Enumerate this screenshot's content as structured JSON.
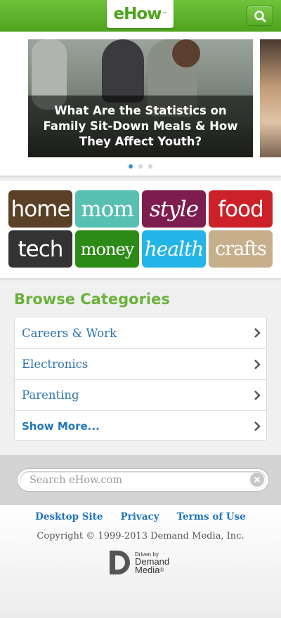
{
  "header": {
    "logo_text": "eHow",
    "logo_tm": "™",
    "search_icon": "search-icon",
    "bg_color": "#5bb22a"
  },
  "carousel": {
    "slides": [
      {
        "caption": "What Are the Statistics on Family Sit-Down Meals & How They Affect Youth?"
      }
    ],
    "active_dot": 1,
    "dot_count": 3
  },
  "brands": [
    {
      "label": "home",
      "color": "#5a4026"
    },
    {
      "label": "mom",
      "color": "#58bfb3"
    },
    {
      "label": "style",
      "color": "#7d1d4f"
    },
    {
      "label": "food",
      "color": "#cc2129"
    },
    {
      "label": "tech",
      "color": "#333333"
    },
    {
      "label": "money",
      "color": "#2c8a16"
    },
    {
      "label": "health",
      "color": "#23b5e8"
    },
    {
      "label": "crafts",
      "color": "#c6af8a"
    }
  ],
  "browse": {
    "title": "Browse Categories",
    "items": [
      {
        "label": "Careers & Work"
      },
      {
        "label": "Electronics"
      },
      {
        "label": "Parenting"
      },
      {
        "label": "Show More..."
      }
    ]
  },
  "search": {
    "placeholder": "Search eHow.com",
    "value": "",
    "clear_icon": "clear-icon"
  },
  "footer": {
    "links": [
      "Desktop Site",
      "Privacy",
      "Terms of Use"
    ],
    "copyright": "Copyright © 1999-2013 Demand Media, Inc.",
    "driven_by": "Driven by",
    "dm_line1": "Demand",
    "dm_line2": "Media",
    "dm_reg": "®"
  }
}
